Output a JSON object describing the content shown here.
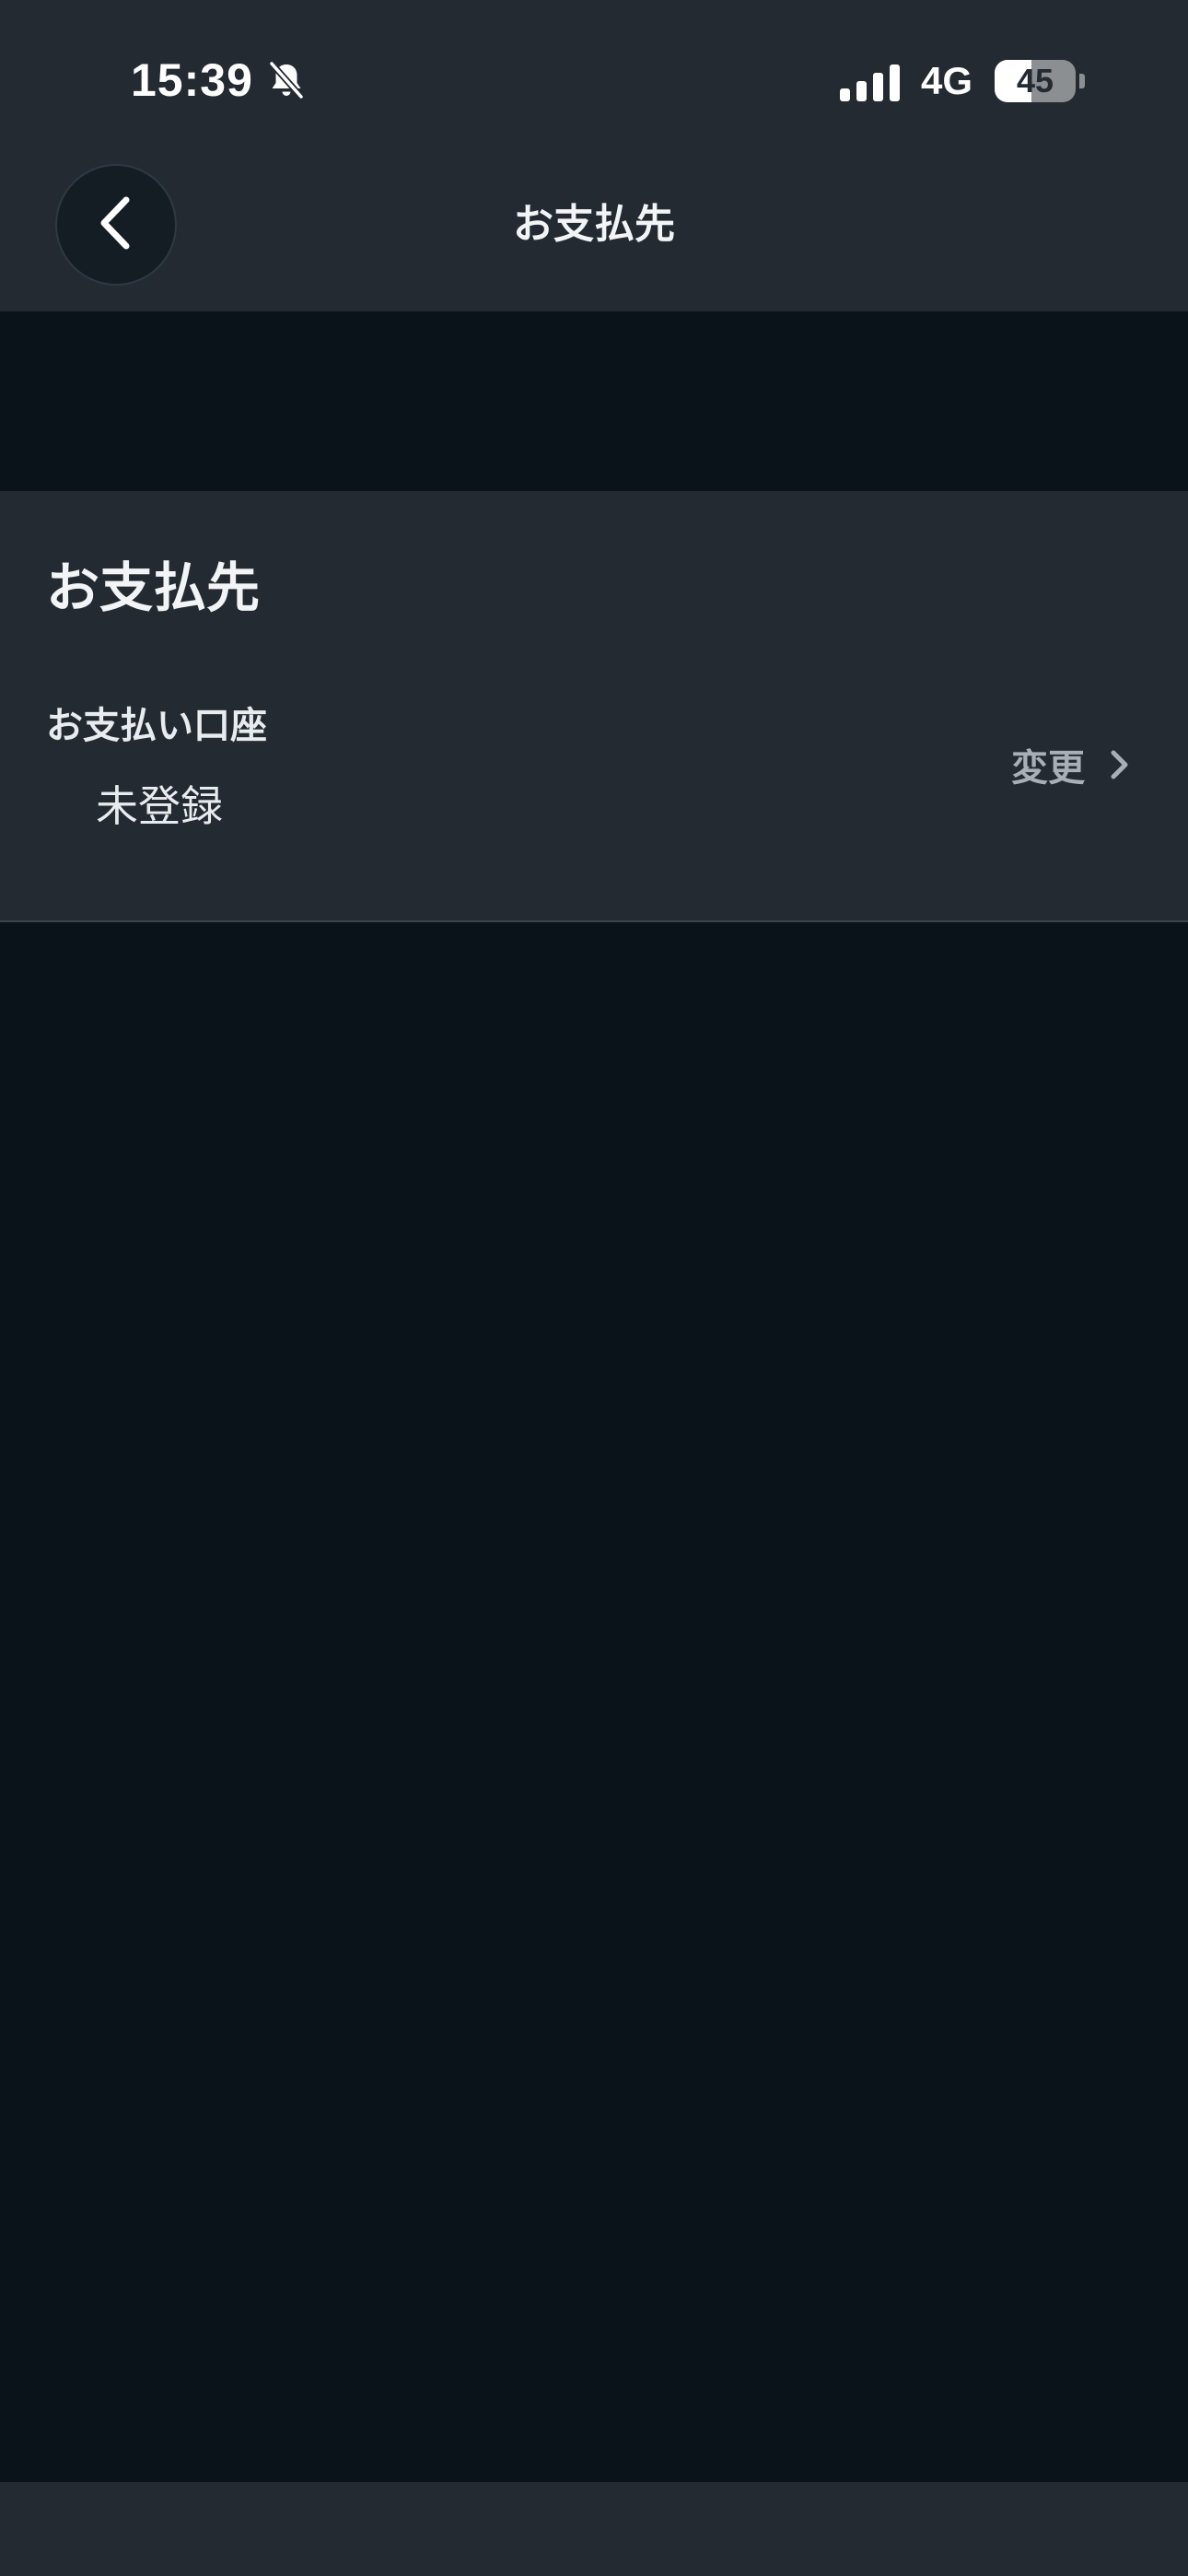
{
  "status_bar": {
    "time": "15:39",
    "silent_icon": "bell-slash",
    "signal_icon": "cellular-signal",
    "network": "4G",
    "battery_level": 45,
    "battery_text": "45"
  },
  "nav": {
    "back_icon": "chevron-left",
    "title": "お支払先"
  },
  "section": {
    "title": "お支払先",
    "payment_account": {
      "label": "お支払い口座",
      "value": "未登録",
      "action_label": "変更",
      "action_icon": "chevron-right"
    }
  },
  "colors": {
    "background": "#0a131a",
    "surface": "#232a32",
    "text_primary": "#f2f4f6",
    "text_secondary": "#a8afb6"
  }
}
